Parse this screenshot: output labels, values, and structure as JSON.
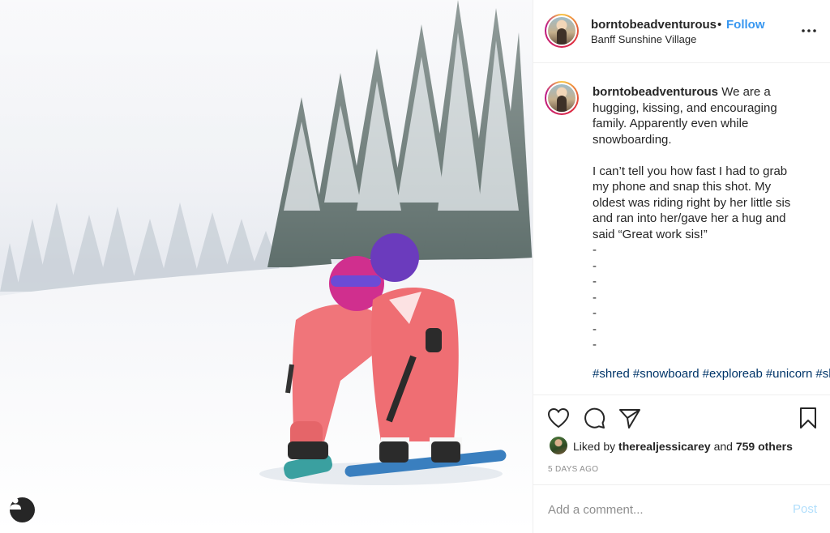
{
  "post": {
    "username": "borntobeadventurous",
    "separator": "•",
    "follow_label": "Follow",
    "location": "Banff Sunshine Village",
    "more_icon": "more-horizontal-icon"
  },
  "caption": {
    "username": "borntobeadventurous",
    "text": "We are a hugging, kissing, and encouraging family. Apparently even while snowboarding.\n\nI can’t tell you how fast I had to grab my phone and snap this shot. My oldest was riding right by her little sis and ran into her/gave her a hug and said “Great work sis!”\n-\n-\n-\n-\n-\n-\n-\n",
    "hashtags": [
      "#shred",
      "#snowboard",
      "#exploreab",
      "#unicorn",
      "#sheshredsco"
    ]
  },
  "actions": {
    "icons": [
      "heart-icon",
      "comment-icon",
      "share-icon",
      "bookmark-icon"
    ]
  },
  "likes": {
    "prefix": "Liked by",
    "user": "therealjessicarey",
    "joiner": "and",
    "others": "759 others"
  },
  "timestamp": "5 DAYS AGO",
  "comment": {
    "placeholder": "Add a comment...",
    "post_label": "Post"
  },
  "colors": {
    "accent": "#3897f0",
    "hashtag": "#003569",
    "muted": "#8e8e8e",
    "post_disabled": "#b2dffc",
    "snowsuit": "#f0757a"
  }
}
